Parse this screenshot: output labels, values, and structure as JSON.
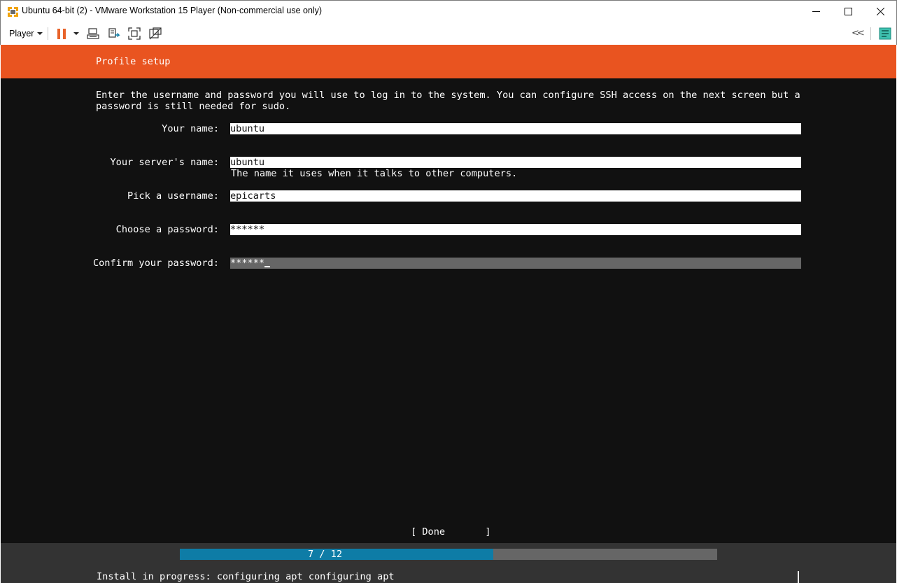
{
  "window": {
    "title": "Ubuntu 64-bit (2) - VMware Workstation 15 Player (Non-commercial use only)",
    "app_icon": "vmware-player-icon",
    "controls": {
      "minimize": "–",
      "maximize": "☐",
      "close": "✕"
    }
  },
  "toolbar": {
    "player_label": "Player",
    "collapse_label": "<<",
    "accent_color": "#e8632a"
  },
  "installer": {
    "header_title": "Profile setup",
    "header_color": "#e95420",
    "intro": "Enter the username and password you will use to log in to the system. You can configure SSH access on the next screen but a\npassword is still needed for sudo.",
    "fields": [
      {
        "label": "Your name:",
        "value": "ubuntu",
        "help": ""
      },
      {
        "label": "Your server's name:",
        "value": "ubuntu",
        "help": "The name it uses when it talks to other computers."
      },
      {
        "label": "Pick a username:",
        "value": "epicarts",
        "help": ""
      },
      {
        "label": "Choose a password:",
        "value": "******",
        "help": ""
      },
      {
        "label": "Confirm your password:",
        "value": "******",
        "help": ""
      }
    ],
    "done_label": "[ Done       ]",
    "progress": {
      "text": "7 / 12",
      "current": 7,
      "total": 12,
      "fill_color": "#0e7ca6"
    },
    "status": "Install in progress: configuring apt configuring apt"
  }
}
